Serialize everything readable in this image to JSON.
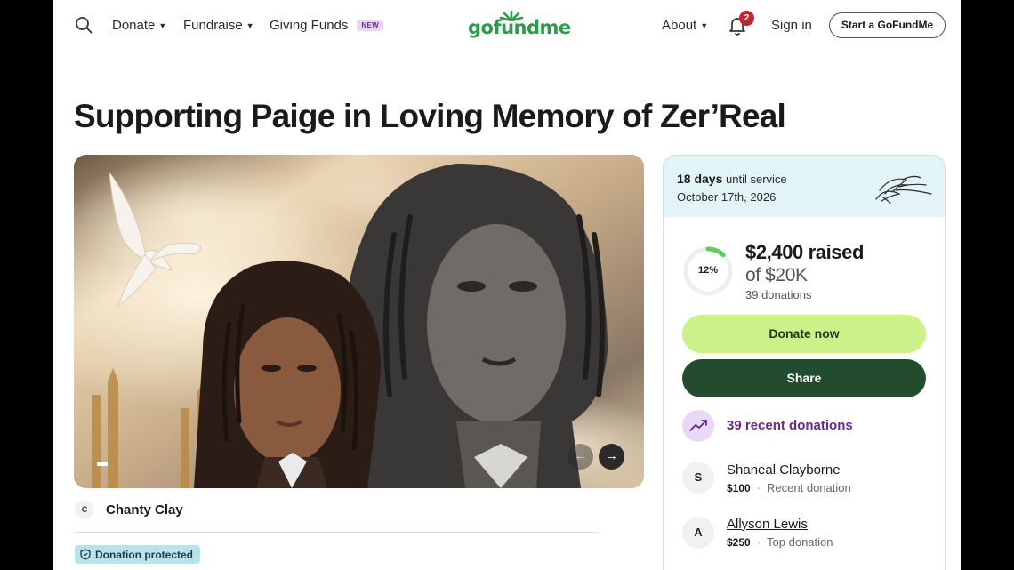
{
  "nav": {
    "donate": "Donate",
    "fundraise": "Fundraise",
    "giving_funds": "Giving Funds",
    "new_badge": "NEW",
    "logo": "gofundme",
    "about": "About",
    "notifications_count": "2",
    "sign_in": "Sign in",
    "start_button": "Start a GoFundMe"
  },
  "campaign": {
    "title": "Supporting Paige in Loving Memory of Zer’Real",
    "organizer_initial": "C",
    "organizer_name": "Chanty Clay",
    "protected_label": "Donation protected"
  },
  "card": {
    "days_count": "18 days",
    "days_suffix": "until service",
    "service_date": "October 17th, 2026",
    "progress_percent": 12,
    "progress_label": "12%",
    "raised": "$2,400 raised",
    "goal": "of $20K",
    "donation_count": "39 donations",
    "donate_button": "Donate now",
    "share_button": "Share",
    "recent_label": "39 recent donations",
    "donors": [
      {
        "initial": "S",
        "name": "Shaneal Clayborne",
        "amount": "$100",
        "type": "Recent donation"
      },
      {
        "initial": "A",
        "name": "Allyson Lewis",
        "amount": "$250",
        "type": "Top donation"
      }
    ]
  },
  "colors": {
    "brand_green": "#2d9b4b",
    "donate_button": "#cbf288",
    "share_button": "#234c2f",
    "accent_purple": "#6b2a8e",
    "protected_bg": "#b9e3ec"
  }
}
